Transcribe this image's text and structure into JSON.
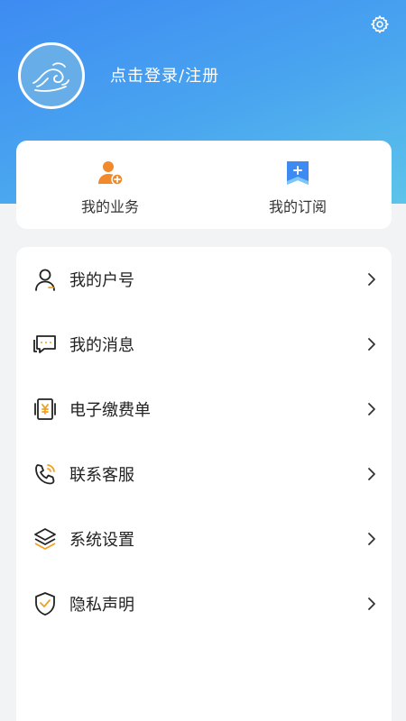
{
  "header": {
    "login_label": "点击登录/注册",
    "settings_icon": "gear-icon",
    "avatar_icon": "wave-logo-icon"
  },
  "quick_actions": [
    {
      "label": "我的业务",
      "icon": "person-add-icon",
      "color": "#f08a2b"
    },
    {
      "label": "我的订阅",
      "icon": "bookmark-plus-icon",
      "color": "#3d8bf2"
    }
  ],
  "menu": [
    {
      "label": "我的户号",
      "icon": "user-icon"
    },
    {
      "label": "我的消息",
      "icon": "message-icon"
    },
    {
      "label": "电子缴费单",
      "icon": "bill-icon"
    },
    {
      "label": "联系客服",
      "icon": "phone-icon"
    },
    {
      "label": "系统设置",
      "icon": "layers-icon"
    },
    {
      "label": "隐私声明",
      "icon": "shield-check-icon"
    }
  ],
  "colors": {
    "header_gradient_start": "#3d8bf2",
    "header_gradient_end": "#5cc4ea",
    "accent_orange": "#f0a020",
    "page_background": "#f2f3f5"
  }
}
